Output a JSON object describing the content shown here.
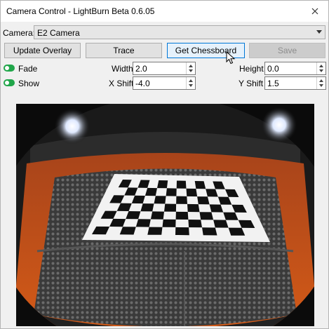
{
  "window": {
    "title": "Camera Control - LightBurn Beta 0.6.05",
    "close_icon": "close-icon"
  },
  "camera_select": {
    "label": "Camera:",
    "value": "E2 Camera"
  },
  "buttons": {
    "update_overlay": "Update Overlay",
    "trace": "Trace",
    "get_chessboard": "Get Chessboard",
    "save": "Save"
  },
  "toggles": {
    "fade": {
      "label": "Fade",
      "on": true
    },
    "show": {
      "label": "Show",
      "on": true
    }
  },
  "fields": {
    "width": {
      "label": "Width",
      "value": "2.0"
    },
    "height": {
      "label": "Height",
      "value": "0.0"
    },
    "x_shift": {
      "label": "X Shift",
      "value": "-4.0"
    },
    "y_shift": {
      "label": "Y Shift",
      "value": "1.5"
    }
  },
  "colors": {
    "toggle_on": "#21a64a",
    "hover_border": "#0078d7",
    "laser_orange": "#d35a18"
  }
}
